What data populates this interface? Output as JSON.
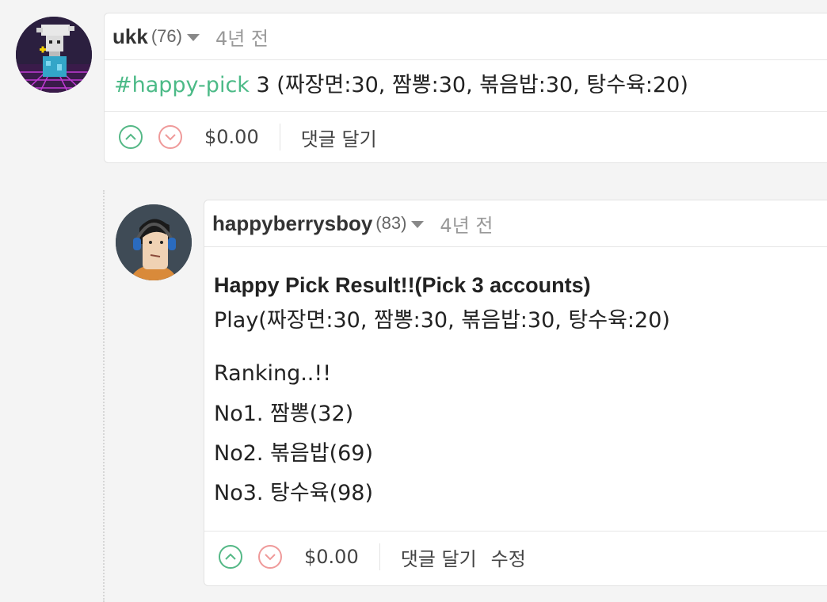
{
  "colors": {
    "accent": "#4cba87",
    "upvote": "#54b886",
    "downvote": "#ef9a9a"
  },
  "comments": [
    {
      "author": "ukk",
      "reputation": "(76)",
      "time": "4년 전",
      "hashtag": "#happy-pick",
      "text": " 3 (짜장면:30, 짬뽕:30, 볶음밥:30, 탕수육:20)",
      "payout": "$0.00",
      "reply_label": "댓글 달기",
      "avatar_icon": "pixel-art-avatar-icon"
    },
    {
      "author": "happyberrysboy",
      "reputation": "(83)",
      "time": "4년 전",
      "lines": [
        "Happy Pick Result!!(Pick 3 accounts)",
        "Play(짜장면:30, 짬뽕:30, 볶음밥:30, 탕수육:20)",
        "Ranking..!!",
        "No1. 짬뽕(32)",
        "No2. 볶음밥(69)",
        "No3. 탕수육(98)"
      ],
      "payout": "$0.00",
      "reply_label": "댓글 달기",
      "edit_label": "수정",
      "avatar_icon": "cartoon-person-headphones-avatar-icon"
    }
  ]
}
